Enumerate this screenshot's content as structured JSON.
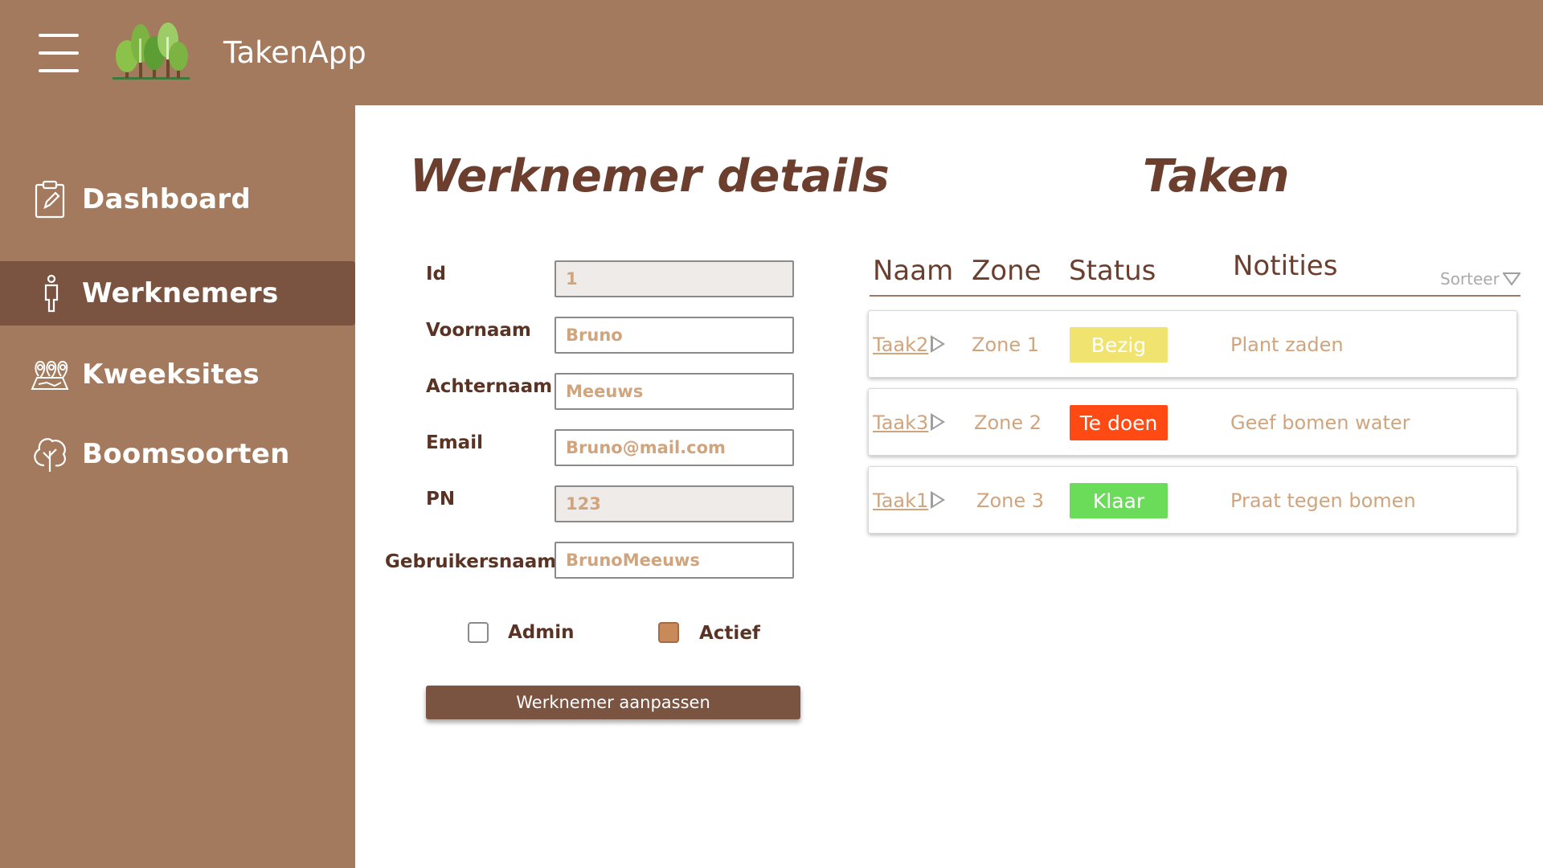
{
  "app": {
    "title": "TakenApp"
  },
  "sidebar": {
    "items": [
      {
        "label": "Dashboard",
        "icon": "clipboard-icon"
      },
      {
        "label": "Werknemers",
        "icon": "person-icon",
        "active": true
      },
      {
        "label": "Kweeksites",
        "icon": "map-icon"
      },
      {
        "label": "Boomsoorten",
        "icon": "tree-icon"
      }
    ]
  },
  "employee": {
    "title": "Werknemer details",
    "fields": {
      "id": {
        "label": "Id",
        "value": "1",
        "disabled": true
      },
      "firstname": {
        "label": "Voornaam",
        "value": "Bruno"
      },
      "lastname": {
        "label": "Achternaam",
        "value": "Meeuws"
      },
      "email": {
        "label": "Email",
        "value": "Bruno@mail.com"
      },
      "pn": {
        "label": "PN",
        "value": "123",
        "disabled": true
      },
      "username": {
        "label": "Gebruikersnaam",
        "value": "BrunoMeeuws"
      }
    },
    "admin": {
      "label": "Admin",
      "checked": false
    },
    "active": {
      "label": "Actief",
      "checked": true
    },
    "save_label": "Werknemer aanpassen"
  },
  "tasks": {
    "title": "Taken",
    "columns": {
      "name": "Naam",
      "zone": "Zone",
      "status": "Status",
      "notes": "Notities"
    },
    "sort_label": "Sorteer",
    "rows": [
      {
        "name": "Taak2",
        "zone": "Zone 1",
        "status": "Bezig",
        "status_color": "#f0e36f",
        "note": "Plant zaden"
      },
      {
        "name": "Taak3",
        "zone": "Zone 2",
        "status": "Te doen",
        "status_color": "#ff4a14",
        "note": "Geef bomen water"
      },
      {
        "name": "Taak1",
        "zone": "Zone 3",
        "status": "Klaar",
        "status_color": "#6bdc5a",
        "note": "Praat tegen bomen"
      }
    ]
  },
  "colors": {
    "brown": "#a37a5e",
    "dark_brown": "#7a5440",
    "heading": "#6b3e2e",
    "muted": "#d0a57e"
  }
}
